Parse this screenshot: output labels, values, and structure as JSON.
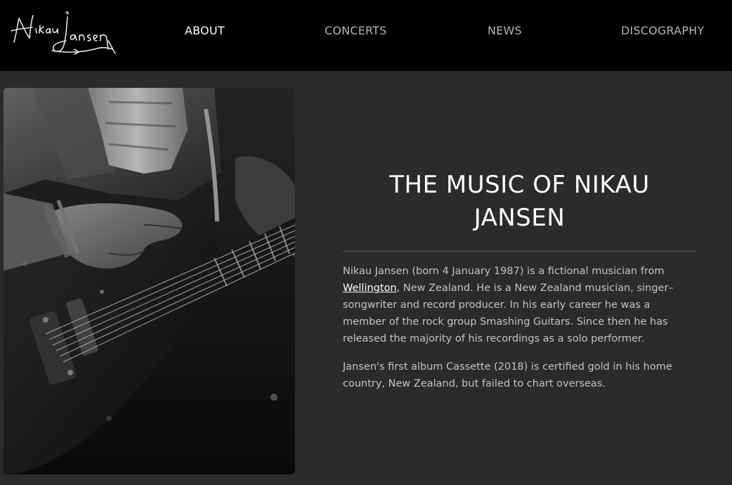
{
  "header": {
    "logo_text": "Nikau Jansen",
    "nav": [
      {
        "label": "ABOUT",
        "active": true
      },
      {
        "label": "CONCERTS",
        "active": false
      },
      {
        "label": "NEWS",
        "active": false
      },
      {
        "label": "DISCOGRAPHY",
        "active": false
      }
    ]
  },
  "main": {
    "headline": "THE MUSIC OF NIKAU JANSEN",
    "bio": {
      "p1_before": "Nikau Jansen (born 4 January 1987) is a fictional musician from ",
      "p1_link": "Wellington",
      "p1_after": ", New Zealand. He is a New Zealand musician, singer–songwriter and record producer. In his early career he was a member of the rock group Smashing Guitars. Since then he has released the majority of his recordings as a solo performer.",
      "p2": "Jansen's first album Cassette (2018) is certified gold in his home country, New Zealand, but failed to chart overseas."
    }
  },
  "colors": {
    "header_bg": "#000000",
    "page_bg": "#2b2b2b",
    "nav_active": "#ffffff",
    "nav_inactive": "#b4b4b4",
    "body_text": "#c3c3c3"
  }
}
